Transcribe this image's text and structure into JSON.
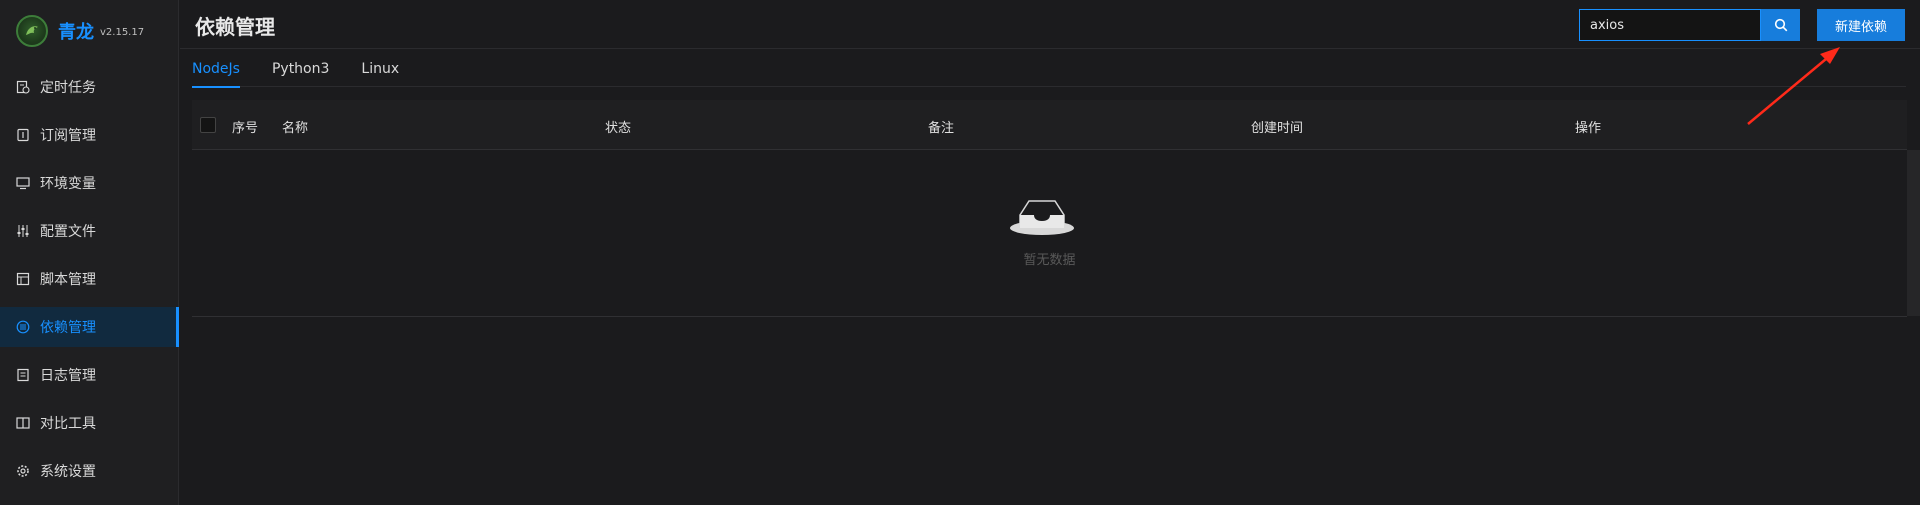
{
  "app": {
    "name": "青龙",
    "version": "v2.15.17"
  },
  "sidebar": {
    "items": [
      {
        "label": "定时任务",
        "icon": "schedule-icon"
      },
      {
        "label": "订阅管理",
        "icon": "subscription-icon"
      },
      {
        "label": "环境变量",
        "icon": "environment-icon"
      },
      {
        "label": "配置文件",
        "icon": "config-sliders-icon"
      },
      {
        "label": "脚本管理",
        "icon": "script-icon"
      },
      {
        "label": "依赖管理",
        "icon": "dependency-icon",
        "active": true
      },
      {
        "label": "日志管理",
        "icon": "log-icon"
      },
      {
        "label": "对比工具",
        "icon": "diff-icon"
      },
      {
        "label": "系统设置",
        "icon": "gear-icon"
      }
    ]
  },
  "header": {
    "title": "依赖管理",
    "search_value": "axios",
    "create_label": "新建依赖"
  },
  "tabs": [
    {
      "label": "NodeJs",
      "active": true
    },
    {
      "label": "Python3"
    },
    {
      "label": "Linux"
    }
  ],
  "table": {
    "columns": [
      "序号",
      "名称",
      "状态",
      "备注",
      "创建时间",
      "操作"
    ],
    "rows": [],
    "empty_text": "暂无数据"
  },
  "colors": {
    "accent": "#1890ff",
    "background": "#1b1b1d",
    "annotation": "#ff2a1a"
  }
}
